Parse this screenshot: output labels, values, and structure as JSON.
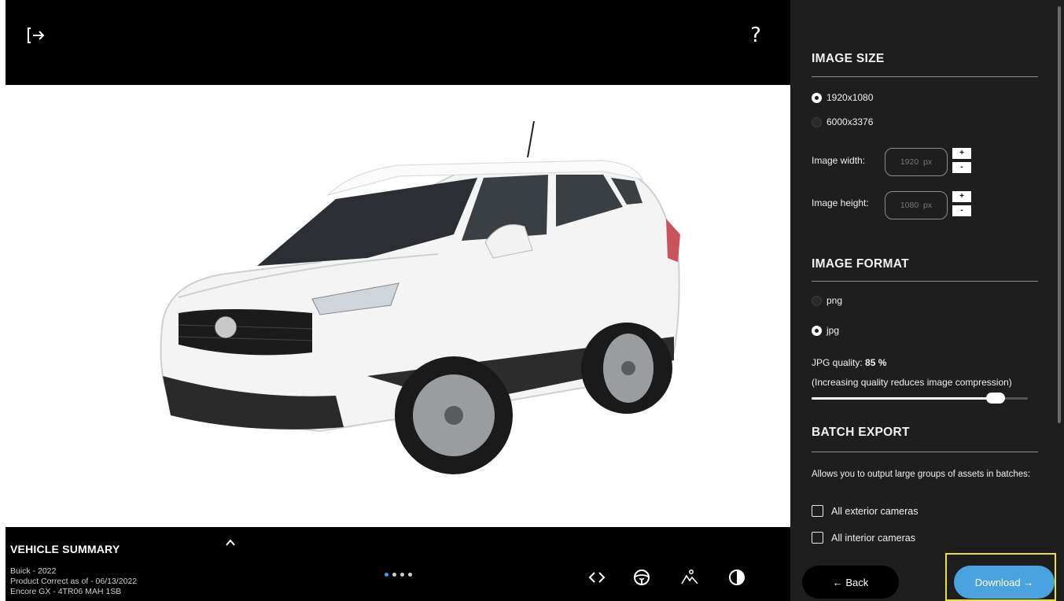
{
  "viewer": {
    "exit_icon": "exit-icon",
    "help_label": "?"
  },
  "summary": {
    "title": "VEHICLE SUMMARY",
    "lines": [
      "Buick - 2022",
      "Product Correct as of - 06/13/2022",
      "Encore GX - 4TR06 MAH 1SB"
    ],
    "toggle_icon": "chevron-up-icon"
  },
  "toolbar": {
    "carousel_dots": 4,
    "icons": [
      "code-arrows-icon",
      "steering-wheel-icon",
      "landscape-icon",
      "contrast-icon"
    ]
  },
  "image_size": {
    "title": "IMAGE SIZE",
    "options": [
      {
        "label": "1920x1080",
        "checked": true
      },
      {
        "label": "6000x3376",
        "checked": false
      }
    ],
    "width_label": "Image width:",
    "width_placeholder": "1920  px",
    "height_label": "Image height:",
    "height_placeholder": "1080  px",
    "plus": "+",
    "minus": "-"
  },
  "image_format": {
    "title": "IMAGE FORMAT",
    "options": [
      {
        "label": "png",
        "checked": false
      },
      {
        "label": "jpg",
        "checked": true
      }
    ],
    "quality_label": "JPG quality:",
    "quality_value": "85 %",
    "quality_fraction": 0.85,
    "quality_note": "(Increasing quality reduces image compression)"
  },
  "batch_export": {
    "title": "BATCH EXPORT",
    "description": "Allows you to output large groups of assets in batches:",
    "options": [
      "All exterior cameras",
      "All interior cameras"
    ]
  },
  "footer": {
    "back_label": "← Back",
    "download_label": "Download →"
  },
  "colors": {
    "accent": "#4aa3df",
    "highlight": "#e6e23a",
    "panel": "#1e1e1e"
  }
}
